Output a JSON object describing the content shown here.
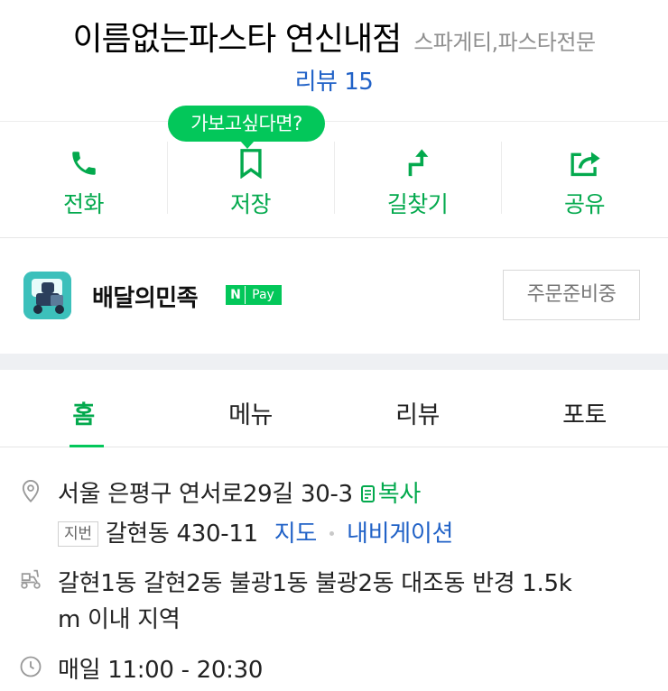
{
  "header": {
    "title": "이름없는파스타 연신내점",
    "category": "스파게티,파스타전문",
    "review_link": "리뷰 15"
  },
  "tooltip": "가보고싶다면?",
  "actions": [
    {
      "label": "전화",
      "icon": "phone-icon"
    },
    {
      "label": "저장",
      "icon": "bookmark-icon"
    },
    {
      "label": "길찾기",
      "icon": "directions-icon"
    },
    {
      "label": "공유",
      "icon": "share-icon"
    }
  ],
  "delivery": {
    "app_name": "배달의민족",
    "npay_n": "N",
    "npay_pay": "Pay",
    "order_status": "주문준비중"
  },
  "tabs": [
    {
      "label": "홈",
      "active": true
    },
    {
      "label": "메뉴",
      "active": false
    },
    {
      "label": "리뷰",
      "active": false
    },
    {
      "label": "포토",
      "active": false
    }
  ],
  "info": {
    "address": "서울 은평구 연서로29길 30-3",
    "copy_label": "복사",
    "jibun_badge": "지번",
    "jibun_address": "갈현동 430-11",
    "map_link": "지도",
    "navi_link": "내비게이션",
    "delivery_area_line1": "갈현1동 갈현2동 불광1동 불광2동 대조동 반경 1.5k",
    "delivery_area_line2": "m 이내 지역",
    "hours": "매일 11:00 - 20:30"
  },
  "colors": {
    "brand_green": "#03c75a",
    "label_green": "#03a94d",
    "link_blue": "#2162c7",
    "band_gray": "#eef0f3"
  }
}
